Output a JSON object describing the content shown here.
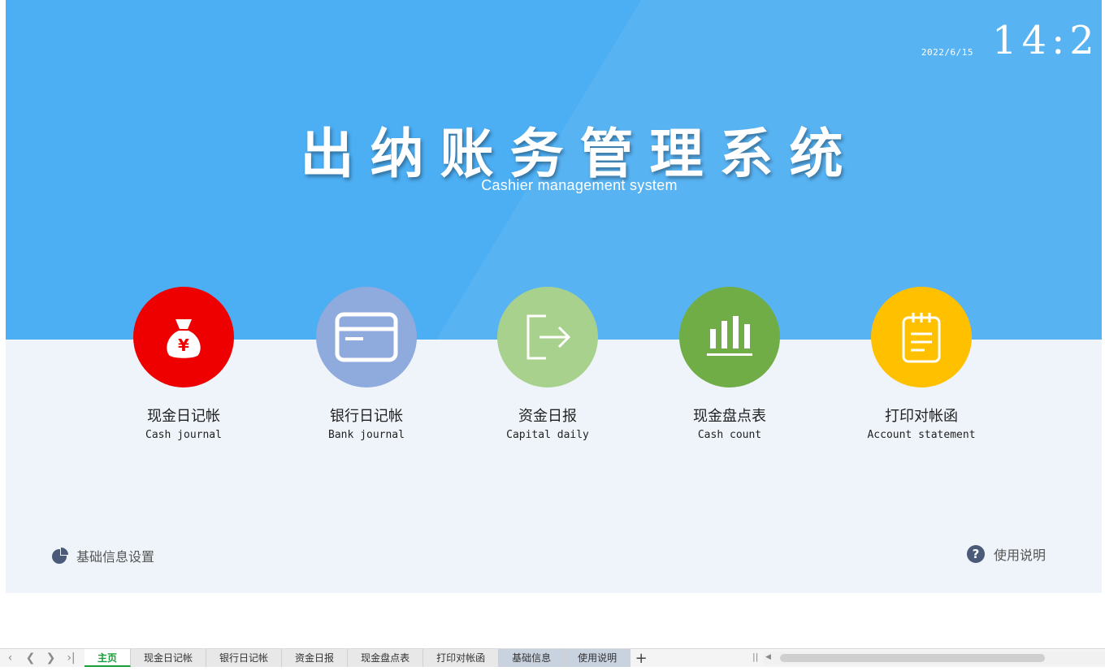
{
  "header": {
    "date": "2022/6/15",
    "clock": "14:2",
    "title": "出纳账务管理系统",
    "subtitle": "Cashier management system"
  },
  "tiles": [
    {
      "label_cn": "现金日记帐",
      "label_en": "Cash journal",
      "color": "#ee0000",
      "icon": "money-bag-icon"
    },
    {
      "label_cn": "银行日记帐",
      "label_en": "Bank journal",
      "color": "#8faadc",
      "icon": "bank-card-icon"
    },
    {
      "label_cn": "资金日报",
      "label_en": "Capital daily",
      "color": "#a9d18e",
      "icon": "export-icon"
    },
    {
      "label_cn": "现金盘点表",
      "label_en": "Cash count",
      "color": "#70ad47",
      "icon": "bar-chart-icon"
    },
    {
      "label_cn": "打印对帐函",
      "label_en": "Account statement",
      "color": "#ffc000",
      "icon": "notepad-icon"
    }
  ],
  "links": {
    "basic_settings": "基础信息设置",
    "help": "使用说明"
  },
  "tabbar": {
    "tabs": [
      "主页",
      "现金日记帐",
      "银行日记帐",
      "资金日报",
      "现金盘点表",
      "打印对帐函",
      "基础信息",
      "使用说明"
    ],
    "active_tab": "主页",
    "add_label": "+"
  },
  "colors": {
    "hero_blue": "#4caef3",
    "panel_bg": "#eef4fa",
    "active_tab": "#1a9e3b",
    "link_icon": "#4a5a78"
  }
}
